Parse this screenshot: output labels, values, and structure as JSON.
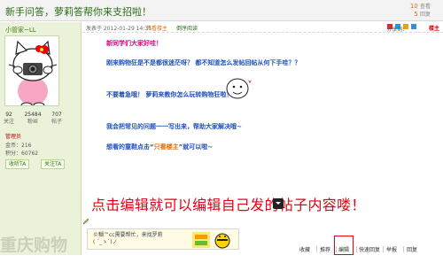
{
  "thread": {
    "title": "新手问答，萝莉答帮你来支招啦！",
    "views": "10",
    "views_label": "查看",
    "replies": "5",
    "replies_label": "回复"
  },
  "user": {
    "name": "小管家~LL",
    "stats": [
      {
        "value": "92",
        "label": "关注"
      },
      {
        "value": "25484",
        "label": "粉丝"
      },
      {
        "value": "707",
        "label": "帖子"
      }
    ],
    "role": "管理员",
    "lines": [
      "金币：216",
      "积分：60762"
    ],
    "btn_follow": "收听TA",
    "btn_msg": "关注TA"
  },
  "post": {
    "meta_prefix": "发表于 2012-01-29 14:35",
    "meta_author": "只看楼主",
    "meta_mode": "倒序阅读",
    "share_label": "分享到：",
    "floor": "楼主",
    "lines": [
      "新同学们大家好哇！",
      "刚来购物狂是不是都很迷茫呀？ 都不知道怎么发帖回帖从何下手哇？？",
      "不要着急哦！ 萝莉来教你怎么玩转购物狂啦！",
      "我会把常见的问题一一写出来，帮助大家解决哦~",
      "想看的童鞋点击“",
      "只看楼主",
      "”就可以啦~"
    ]
  },
  "overlay_text": "点击编辑就可以编辑自己发的帖子内容喽！",
  "signature": {
    "line1": "©糊™cc需要帮忙，来找罗莉 ",
    "line2": "( ´_ゝ`)ノ"
  },
  "actions": [
    "收藏",
    "推荐",
    "编辑",
    "快速回复",
    "举报",
    "回复"
  ],
  "watermark": "重庆购物"
}
